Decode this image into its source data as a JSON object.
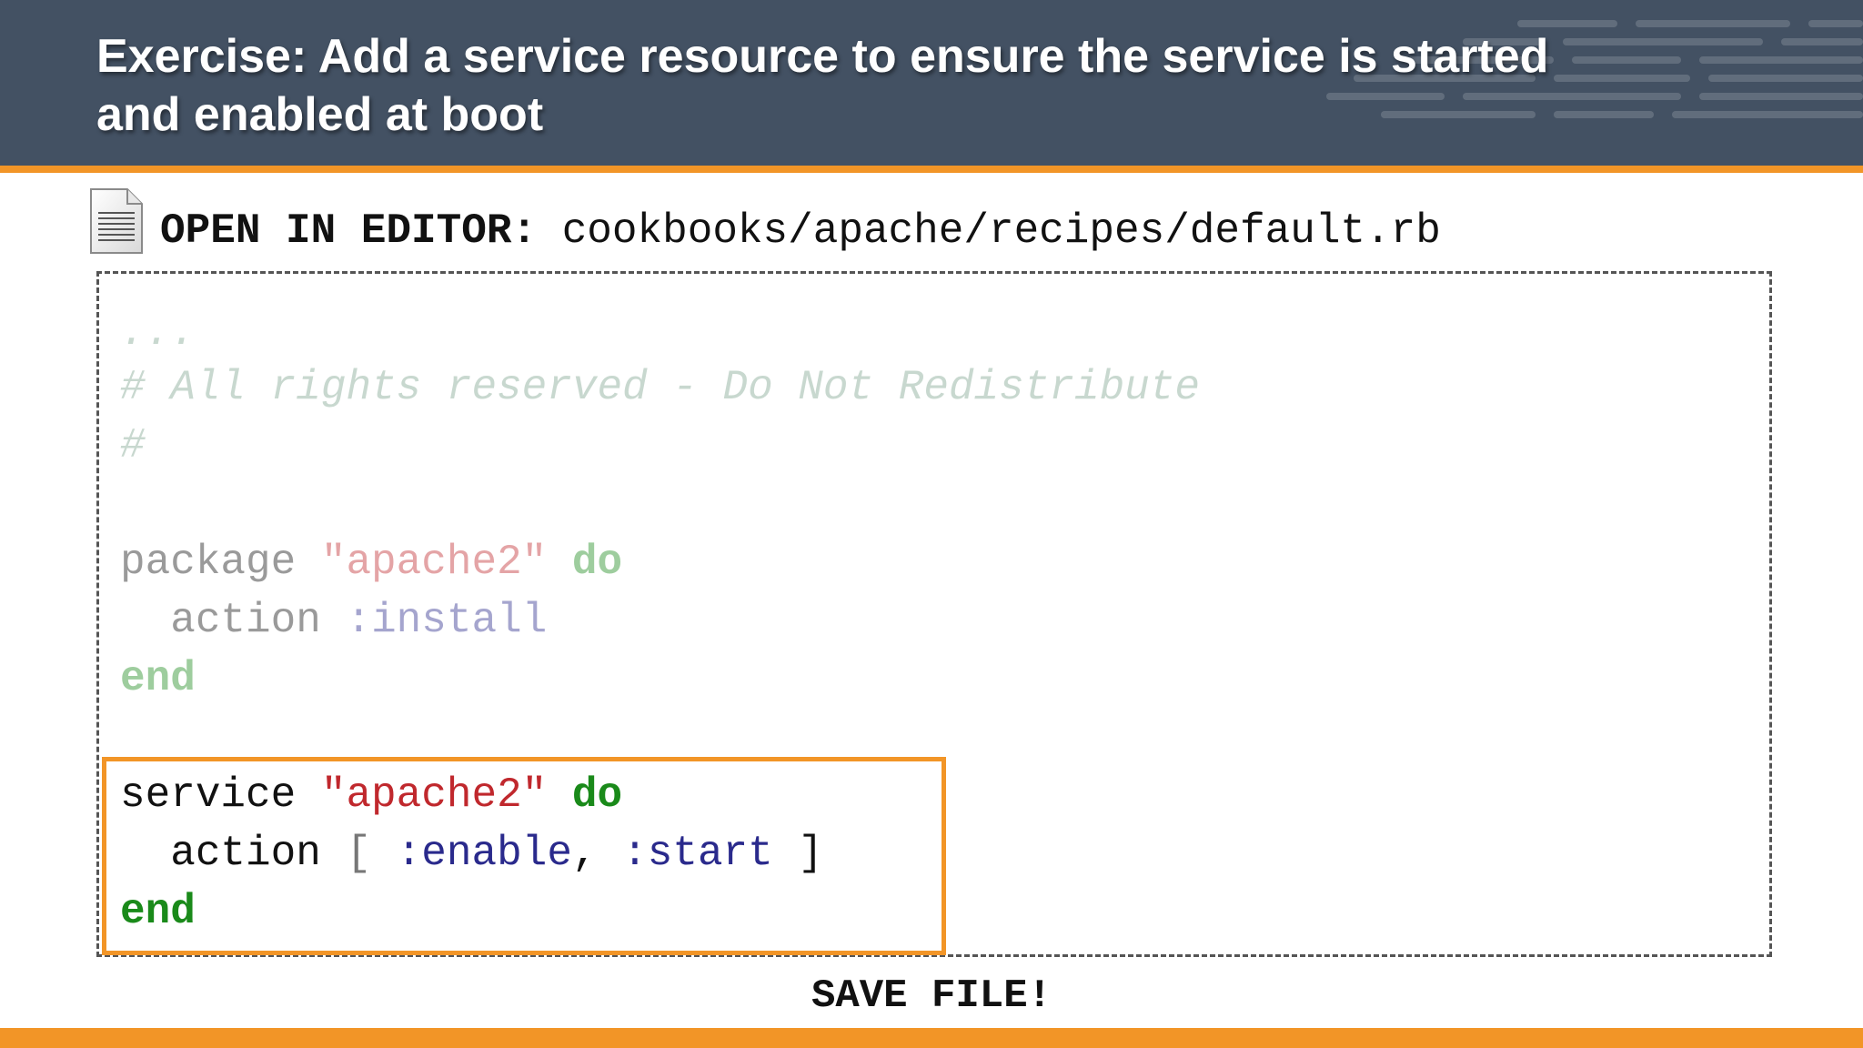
{
  "header": {
    "title_line1": "Exercise:  Add a service resource to ensure the service is started",
    "title_line2": "and enabled at boot"
  },
  "open_in_editor": {
    "label": "OPEN IN EDITOR:",
    "path": "cookbooks/apache/recipes/default.rb",
    "icon": "document-icon"
  },
  "code": {
    "ellipsis": "...",
    "comment1": "# All rights reserved - Do Not Redistribute",
    "comment2": "#",
    "package_kw": "package",
    "package_name": "\"apache2\"",
    "do_kw": "do",
    "action_kw": "action",
    "install_sym": ":install",
    "end_kw": "end",
    "service_kw": "service",
    "service_name": "\"apache2\"",
    "open_bracket": "[",
    "enable_sym": ":enable",
    "comma": ",",
    "start_sym": ":start",
    "close_bracket": "]"
  },
  "footer": {
    "save_text": "SAVE FILE!"
  },
  "colors": {
    "header_bg": "#435163",
    "accent_orange": "#f29527",
    "keyword": "#1a8a1a",
    "string": "#c0282d",
    "symbol": "#2a2a8c",
    "comment": "#7da38e"
  }
}
